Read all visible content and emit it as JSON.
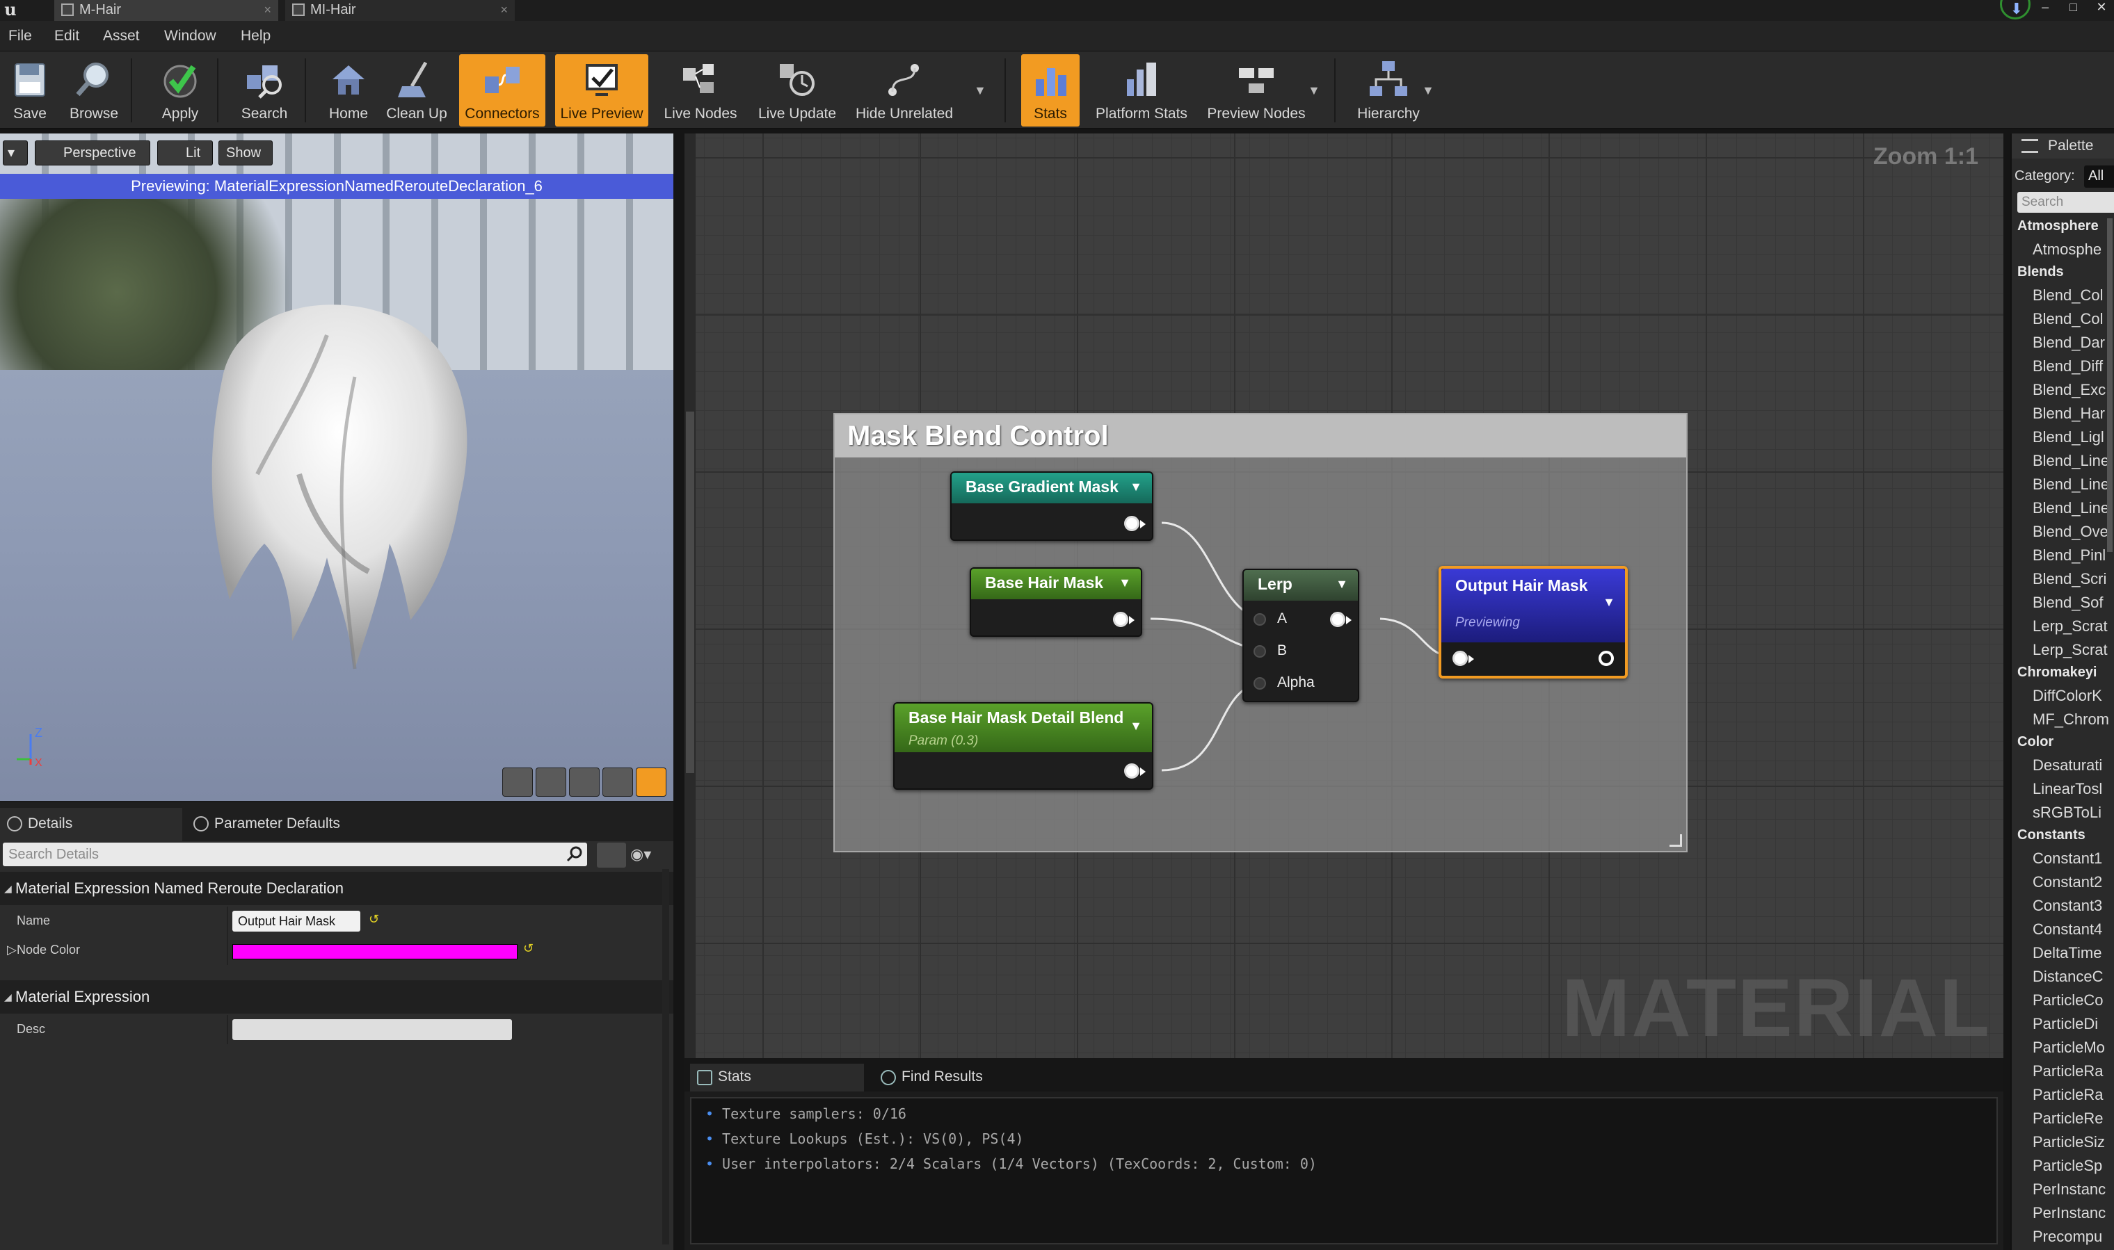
{
  "window": {
    "tabs": [
      {
        "label": "M-Hair",
        "active": true
      },
      {
        "label": "MI-Hair",
        "active": false
      }
    ],
    "controls": {
      "minimize": "‒",
      "maximize": "□",
      "close": "✕"
    }
  },
  "menu": {
    "items": [
      "File",
      "Edit",
      "Asset",
      "Window",
      "Help"
    ]
  },
  "toolbar": {
    "buttons": [
      {
        "label": "Save",
        "icon": "save-icon"
      },
      {
        "label": "Browse",
        "icon": "browse-icon"
      },
      {
        "label": "Apply",
        "icon": "apply-check-icon"
      },
      {
        "label": "Search",
        "icon": "search-nodes-icon"
      },
      {
        "label": "Home",
        "icon": "home-icon"
      },
      {
        "label": "Clean Up",
        "icon": "clean-up-icon"
      },
      {
        "label": "Connectors",
        "icon": "connectors-icon",
        "active": true
      },
      {
        "label": "Live Preview",
        "icon": "live-preview-icon",
        "active": true
      },
      {
        "label": "Live Nodes",
        "icon": "live-nodes-icon"
      },
      {
        "label": "Live Update",
        "icon": "live-update-icon"
      },
      {
        "label": "Hide Unrelated",
        "icon": "hide-unrelated-icon"
      },
      {
        "label": "Stats",
        "icon": "stats-icon",
        "active": true
      },
      {
        "label": "Platform Stats",
        "icon": "platform-stats-icon"
      },
      {
        "label": "Preview Nodes",
        "icon": "preview-nodes-icon"
      },
      {
        "label": "Hierarchy",
        "icon": "hierarchy-icon"
      }
    ],
    "active_color": "#f29b22"
  },
  "viewport": {
    "buttons": {
      "perspective": "Perspective",
      "lit": "Lit",
      "show": "Show"
    },
    "banner": "Previewing: MaterialExpressionNamedRerouteDeclaration_6",
    "banner_color": "#4a5bd8",
    "axis": {
      "z": "Z",
      "x": "X"
    }
  },
  "details": {
    "tabs": [
      "Details",
      "Parameter Defaults"
    ],
    "search_placeholder": "Search Details",
    "categories": [
      {
        "title": "Material Expression Named Reroute Declaration",
        "props": [
          {
            "label": "Name",
            "value": "Output Hair Mask"
          },
          {
            "label": "Node Color",
            "value": "#ff00ff"
          }
        ]
      },
      {
        "title": "Material Expression",
        "props": [
          {
            "label": "Desc",
            "value": ""
          }
        ]
      }
    ]
  },
  "graph": {
    "zoom": "Zoom 1:1",
    "watermark": "MATERIAL",
    "comment": "Mask Blend Control",
    "nodes": {
      "base_gradient": {
        "title": "Base Gradient Mask",
        "color": "#1d8c78"
      },
      "base_hair": {
        "title": "Base Hair Mask",
        "color": "#4c8a24"
      },
      "detail_blend": {
        "title": "Base Hair Mask Detail Blend",
        "subtitle": "Param (0.3)",
        "color": "#4c8a24"
      },
      "lerp": {
        "title": "Lerp",
        "pins": [
          "A",
          "B",
          "Alpha"
        ],
        "color": "#3b5a3b"
      },
      "output": {
        "title": "Output Hair Mask",
        "subtitle": "Previewing",
        "color": "#2626a8"
      }
    }
  },
  "bottom_panel": {
    "tabs": [
      "Stats",
      "Find Results"
    ],
    "lines": [
      "Texture samplers: 0/16",
      "Texture Lookups (Est.): VS(0), PS(4)",
      "User interpolators: 2/4 Scalars (1/4 Vectors) (TexCoords: 2, Custom: 0)"
    ]
  },
  "palette": {
    "tab": "Palette",
    "category_label": "Category:",
    "category_value": "All",
    "search_placeholder": "Search",
    "groups": [
      {
        "name": "Atmosphere",
        "items": [
          "Atmosphe"
        ]
      },
      {
        "name": "Blends",
        "items": [
          "Blend_Col",
          "Blend_Col",
          "Blend_Dar",
          "Blend_Diff",
          "Blend_Exc",
          "Blend_Har",
          "Blend_Ligl",
          "Blend_Line",
          "Blend_Line",
          "Blend_Line",
          "Blend_Ove",
          "Blend_Pinl",
          "Blend_Scri",
          "Blend_Sof",
          "Lerp_Scrat",
          "Lerp_Scrat"
        ]
      },
      {
        "name": "Chromakeyi",
        "items": [
          "DiffColorK",
          "MF_Chrom"
        ]
      },
      {
        "name": "Color",
        "items": [
          "Desaturati",
          "LinearTosl",
          "sRGBToLi"
        ]
      },
      {
        "name": "Constants",
        "items": [
          "Constant1",
          "Constant2",
          "Constant3",
          "Constant4",
          "DeltaTime",
          "DistanceC",
          "ParticleCo",
          "ParticleDi",
          "ParticleMo",
          "ParticleRa",
          "ParticleRa",
          "ParticleRe",
          "ParticleSiz",
          "ParticleSp",
          "PerInstanc",
          "PerInstanc",
          "Precompu"
        ]
      }
    ]
  }
}
